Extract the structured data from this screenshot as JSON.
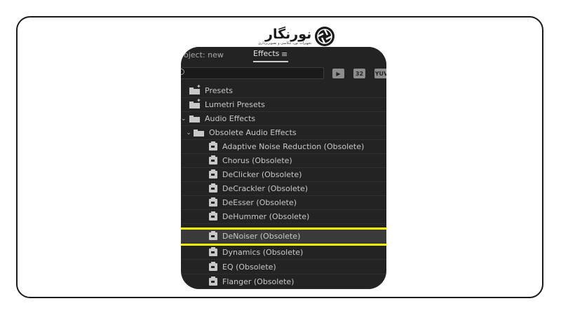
{
  "logo": {
    "name": "نورنگار",
    "tagline": "تجهیزات نور، عکاسی و تصویربرداری"
  },
  "panel": {
    "tabs": [
      {
        "label": "oject: new"
      },
      {
        "label": "Effects"
      }
    ],
    "menu_icon": "≡",
    "filter_buttons": [
      {
        "label": "▶",
        "icon": "accelerated-effects-icon"
      },
      {
        "label": "32",
        "icon": "32bit-effects-icon"
      },
      {
        "label": "YUV",
        "icon": "yuv-effects-icon"
      }
    ],
    "items": [
      {
        "label": "Presets",
        "type": "folder-star"
      },
      {
        "label": "Lumetri Presets",
        "type": "folder-star"
      },
      {
        "label": "Audio Effects",
        "type": "folder",
        "expanded": true
      },
      {
        "label": "Obsolete Audio Effects",
        "type": "folder",
        "expanded": true
      },
      {
        "label": "Adaptive Noise Reduction (Obsolete)",
        "type": "effect"
      },
      {
        "label": "Chorus (Obsolete)",
        "type": "effect"
      },
      {
        "label": "DeClicker (Obsolete)",
        "type": "effect"
      },
      {
        "label": "DeCrackler (Obsolete)",
        "type": "effect"
      },
      {
        "label": "DeEsser (Obsolete)",
        "type": "effect"
      },
      {
        "label": "DeHummer (Obsolete)",
        "type": "effect"
      },
      {
        "label": "DeNoiser (Obsolete)",
        "type": "effect",
        "selected": true
      },
      {
        "label": "Dynamics (Obsolete)",
        "type": "effect"
      },
      {
        "label": "EQ (Obsolete)",
        "type": "effect"
      },
      {
        "label": "Flanger (Obsolete)",
        "type": "effect"
      }
    ]
  },
  "colors": {
    "panel_bg": "#232323",
    "highlight": "#ffff00",
    "text": "#c8c8c8"
  }
}
